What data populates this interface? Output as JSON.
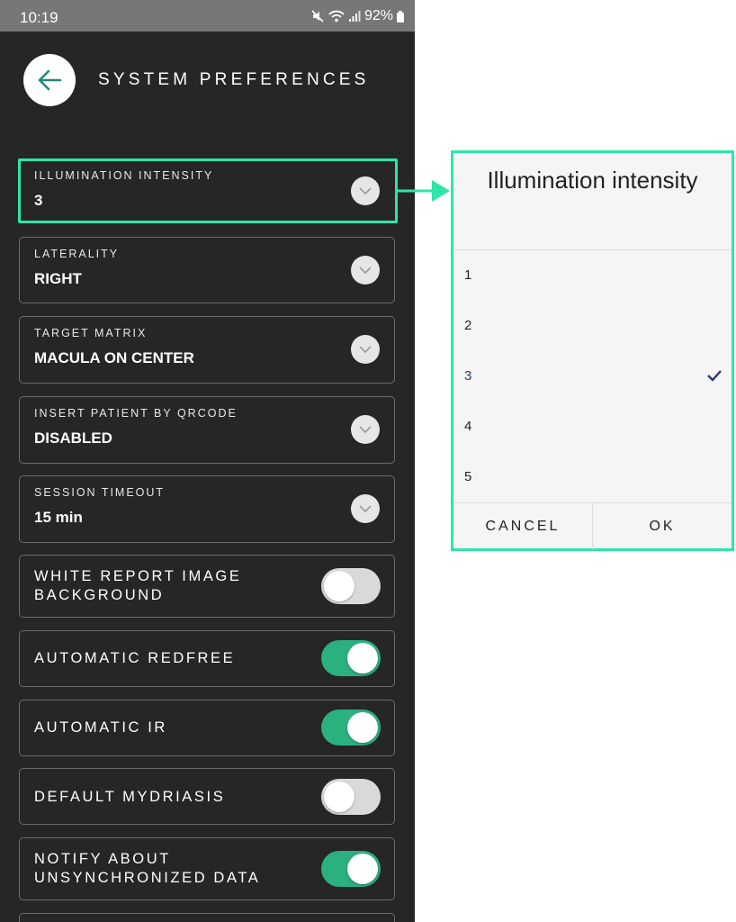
{
  "status_bar": {
    "time": "10:19",
    "battery": "92%"
  },
  "header": {
    "title": "SYSTEM PREFERENCES",
    "back_icon": "arrow-left-icon"
  },
  "selects": [
    {
      "label": "ILLUMINATION INTENSITY",
      "value": "3"
    },
    {
      "label": "LATERALITY",
      "value": "RIGHT"
    },
    {
      "label": "TARGET MATRIX",
      "value": "MACULA ON CENTER"
    },
    {
      "label": "INSERT PATIENT BY QRCODE",
      "value": "DISABLED"
    },
    {
      "label": "SESSION TIMEOUT",
      "value": "15 min"
    }
  ],
  "toggles": [
    {
      "line1": "WHITE REPORT IMAGE",
      "line2": "BACKGROUND",
      "state": "off"
    },
    {
      "line1": "AUTOMATIC REDFREE",
      "line2": "",
      "state": "on"
    },
    {
      "line1": "AUTOMATIC IR",
      "line2": "",
      "state": "on"
    },
    {
      "line1": "DEFAULT MYDRIASIS",
      "line2": "",
      "state": "off"
    },
    {
      "line1": "NOTIFY ABOUT",
      "line2": "UNSYNCHRONIZED DATA",
      "state": "on"
    }
  ],
  "dialog": {
    "title": "Illumination intensity",
    "options": [
      "1",
      "2",
      "3",
      "4",
      "5"
    ],
    "selected": "3",
    "cancel_label": "CANCEL",
    "ok_label": "OK"
  },
  "colors": {
    "highlight": "#2ee6a6",
    "toggle_on": "#2bb080",
    "background": "#262626",
    "back_arrow": "#1f8a7a"
  }
}
